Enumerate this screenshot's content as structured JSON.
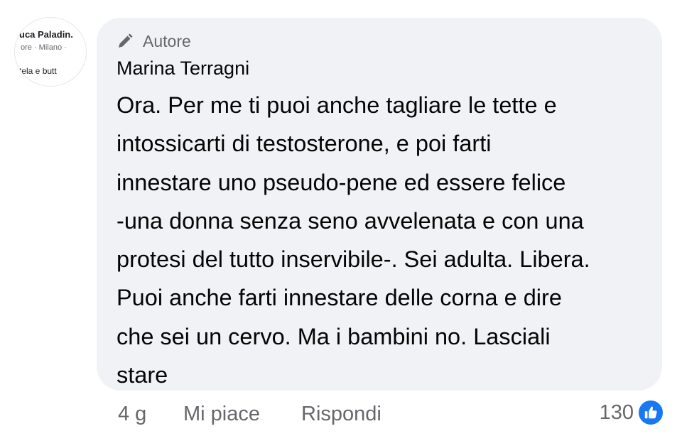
{
  "avatar": {
    "name_fragment": "uca Paladin.",
    "sub_fragment": "ore · Milano ·",
    "text_fragment": "tela e butt"
  },
  "comment": {
    "badge_icon": "pencil-icon",
    "badge_label": "Autore",
    "author": "Marina Terragni",
    "lines": [
      "Ora. Per me ti puoi anche tagliare le tette e",
      "intossicarti di testosterone, e poi farti",
      "innestare uno pseudo-pene ed essere felice",
      "-una donna senza seno avvelenata e con una",
      "protesi del tutto inservibile-. Sei adulta. Libera.",
      "Puoi anche farti innestare delle corna e dire",
      "che sei un cervo. Ma i bambini no. Lasciali",
      "stare"
    ]
  },
  "actions": {
    "time": "4 g",
    "like_label": "Mi piace",
    "reply_label": "Rispondi"
  },
  "reactions": {
    "count": "130",
    "icon": "thumbs-up-icon",
    "color": "#1877f2"
  },
  "colors": {
    "bubble": "#f0f2f5",
    "text": "#050505",
    "secondary_text": "#65676b"
  }
}
